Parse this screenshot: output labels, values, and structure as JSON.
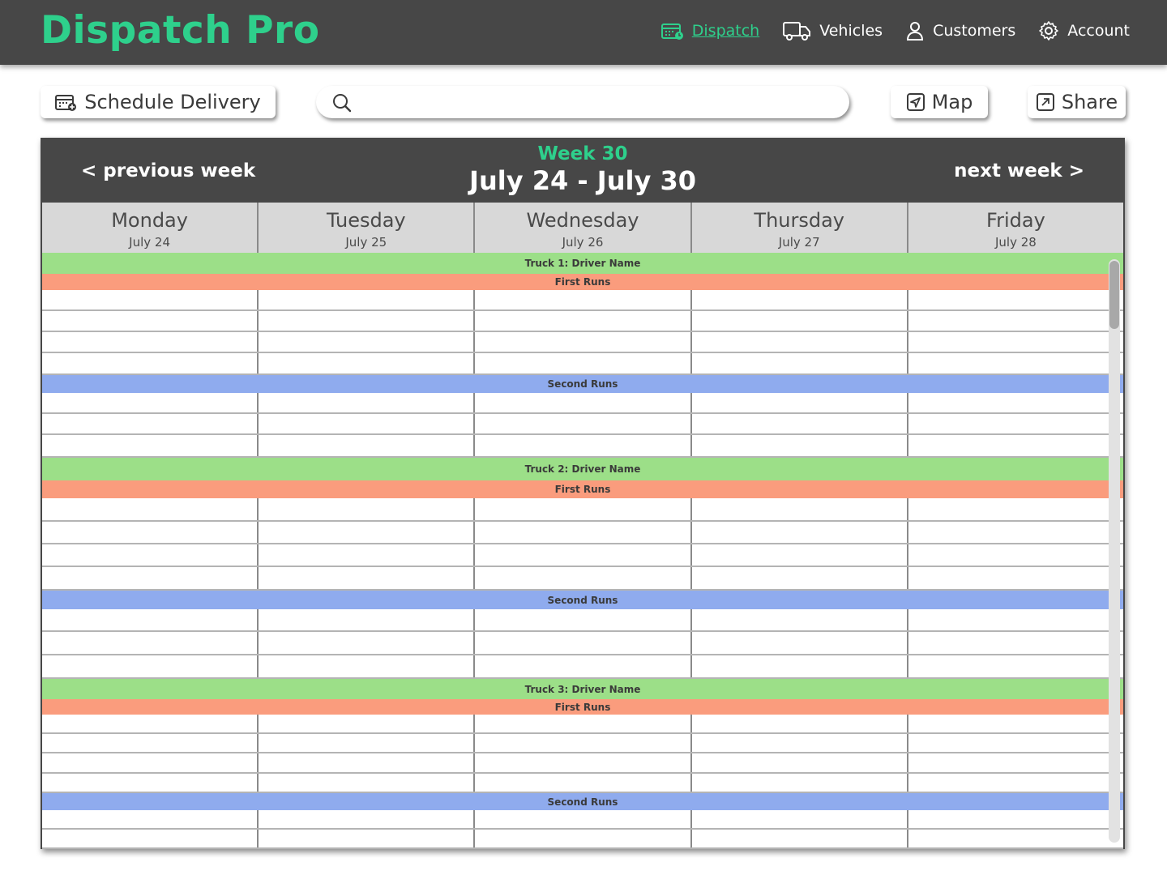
{
  "app": {
    "title": "Dispatch Pro"
  },
  "nav": [
    {
      "label": "Dispatch",
      "icon": "calendar-icon",
      "active": true
    },
    {
      "label": "Vehicles",
      "icon": "truck-icon",
      "active": false
    },
    {
      "label": "Customers",
      "icon": "user-icon",
      "active": false
    },
    {
      "label": "Account",
      "icon": "gear-icon",
      "active": false
    }
  ],
  "toolbar": {
    "schedule_label": "Schedule Delivery",
    "search_placeholder": "",
    "map_label": "Map",
    "share_label": "Share"
  },
  "calendar": {
    "prev_label": "< previous week",
    "next_label": "next week >",
    "week_label": "Week 30",
    "range_label": "July 24 - July 30",
    "days": [
      {
        "name": "Monday",
        "date": "July 24"
      },
      {
        "name": "Tuesday",
        "date": "July 25"
      },
      {
        "name": "Wednesday",
        "date": "July 26"
      },
      {
        "name": "Thursday",
        "date": "July 27"
      },
      {
        "name": "Friday",
        "date": "July 28"
      }
    ],
    "trucks": [
      {
        "label": "Truck 1: Driver Name",
        "first_label": "First Runs",
        "second_label": "Second Runs"
      },
      {
        "label": "Truck 2: Driver Name",
        "first_label": "First Runs",
        "second_label": "Second Runs"
      },
      {
        "label": "Truck 3: Driver Name",
        "first_label": "First Runs",
        "second_label": "Second Runs"
      }
    ]
  },
  "colors": {
    "brand": "#2ed08c",
    "header_bg": "#474747",
    "truck_band": "#9cdf88",
    "first_band": "#fa9c7d",
    "second_band": "#8fabee"
  }
}
